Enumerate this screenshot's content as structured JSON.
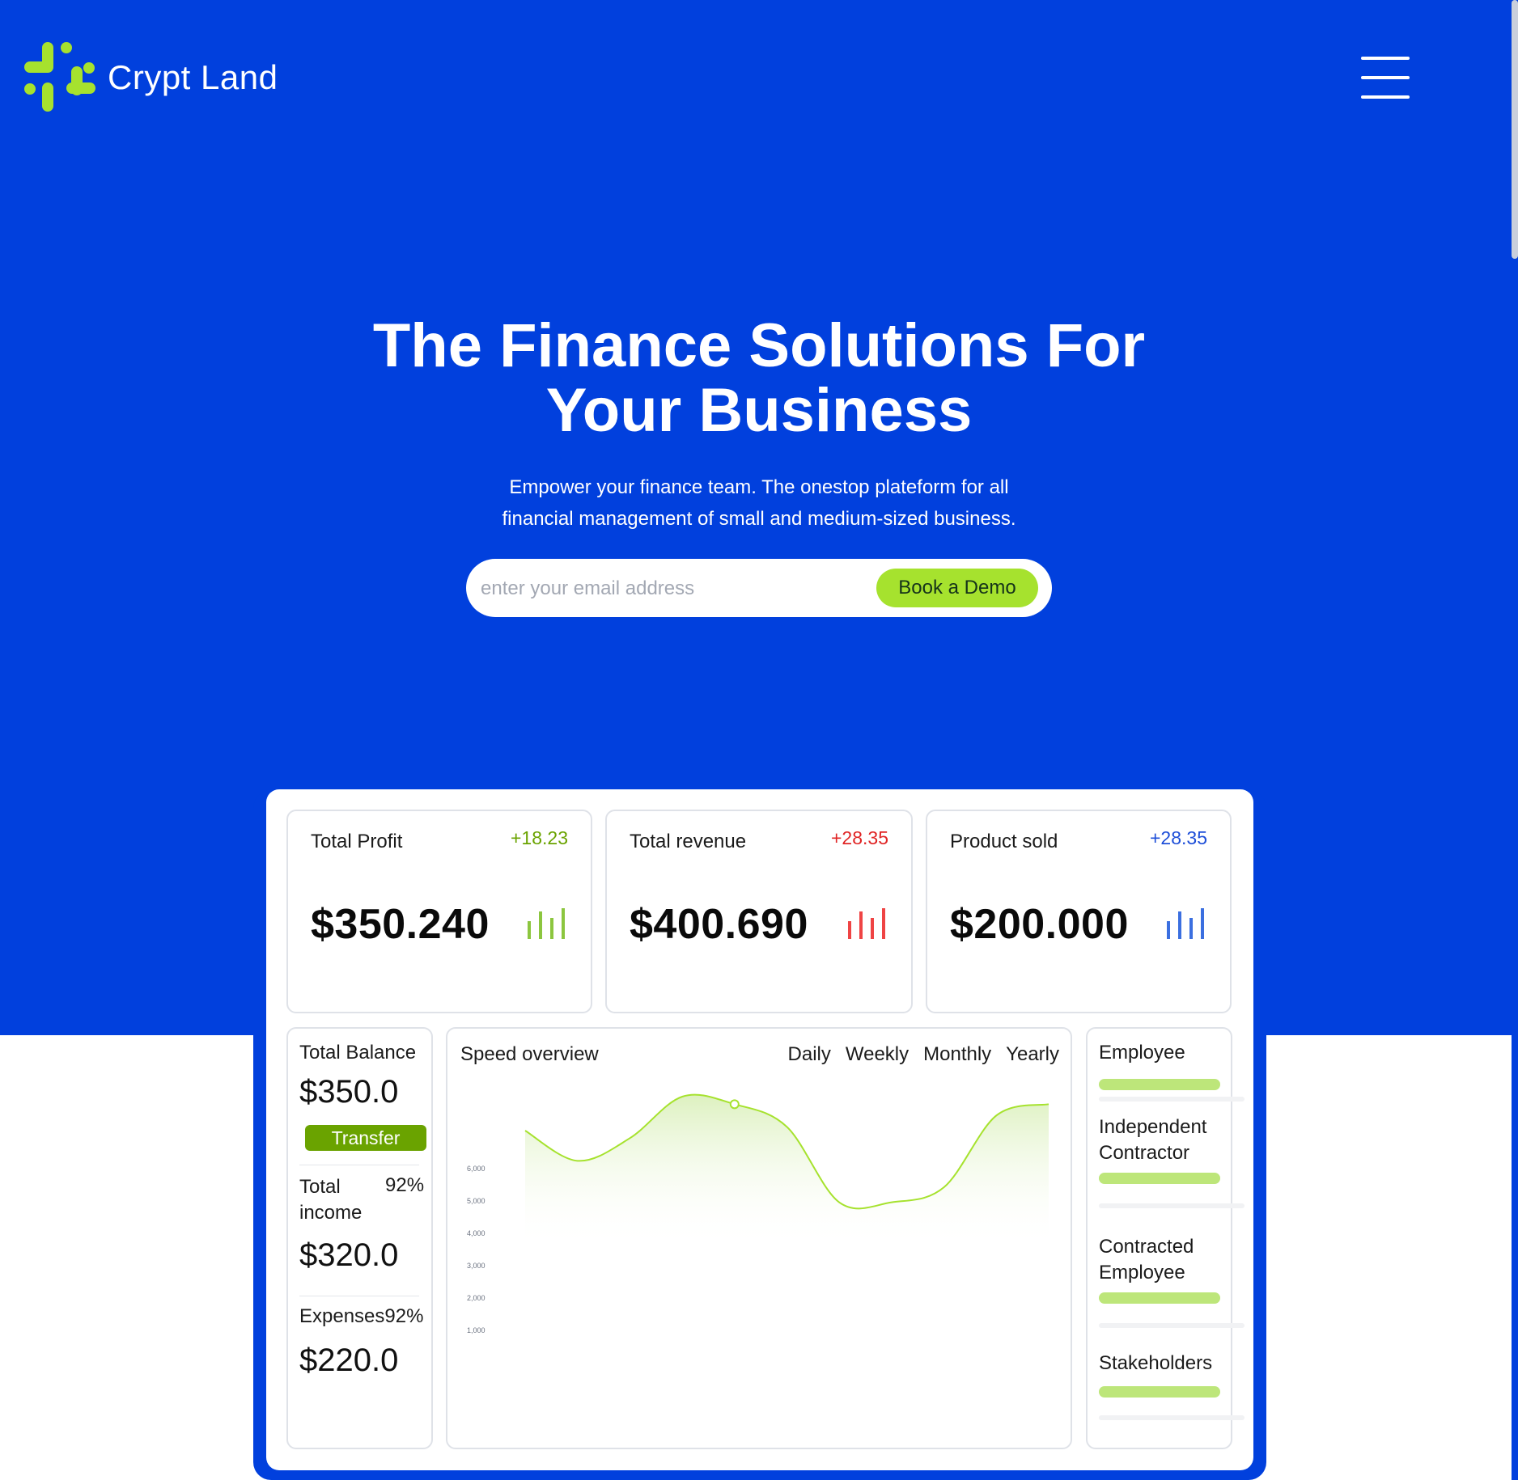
{
  "header": {
    "brand": "Crypt Land",
    "logo_icon": "plus-cross-logo",
    "menu_icon": "hamburger-menu-icon",
    "brand_color": "#0140dd",
    "accent_color": "#a6e22e"
  },
  "hero": {
    "title_line1": "The Finance Solutions For",
    "title_line2": "Your Business",
    "subtitle_line1": "Empower your finance team. The onestop plateform for all",
    "subtitle_line2": "financial management of small and medium-sized business.",
    "email_placeholder": "enter your email address",
    "email_value": "",
    "cta_label": "Book a Demo"
  },
  "dashboard": {
    "stats": [
      {
        "label": "Total Profit",
        "delta": "+18.23",
        "value": "$350.240",
        "color": "#6aa300",
        "bar_color": "#8cc63f"
      },
      {
        "label": "Total revenue",
        "delta": "+28.35",
        "value": "$400.690",
        "color": "#e02424",
        "bar_color": "#ef4444"
      },
      {
        "label": "Product sold",
        "delta": "+28.35",
        "value": "$200.000",
        "color": "#1d4ed8",
        "bar_color": "#3b6fe0"
      }
    ],
    "balance": {
      "title": "Total Balance",
      "amount": "$350.0",
      "transfer_label": "Transfer",
      "income_label_line1": "Total",
      "income_label_line2": "income",
      "income_percent": "92%",
      "income_amount": "$320.0",
      "expenses_label": "Expenses",
      "expenses_percent": "92%",
      "expenses_amount": "$220.0"
    },
    "speed": {
      "title": "Speed overview",
      "tabs": [
        "Daily",
        "Weekly",
        "Monthly",
        "Yearly"
      ]
    },
    "employees": {
      "items": [
        {
          "line1": "Employee",
          "line2": ""
        },
        {
          "line1": "Independent",
          "line2": "Contractor"
        },
        {
          "line1": "Contracted",
          "line2": "Employee"
        },
        {
          "line1": "Stakeholders",
          "line2": ""
        }
      ]
    }
  },
  "chart_data": {
    "type": "area",
    "title": "Speed overview",
    "yticks": [
      "6,000",
      "5,000",
      "4,000",
      "3,000",
      "2,000",
      "1,000"
    ],
    "x": [
      0,
      1,
      2,
      3,
      4,
      5,
      6,
      7,
      8,
      9,
      10
    ],
    "series": [
      {
        "values": [
          5800,
          5000,
          5600,
          6700,
          6500,
          5900,
          3900,
          3900,
          4300,
          6200,
          6500
        ]
      }
    ],
    "highlight_point_index": 4,
    "ylim": [
      1000,
      7000
    ],
    "grid": false,
    "color": "#a6e22e"
  }
}
